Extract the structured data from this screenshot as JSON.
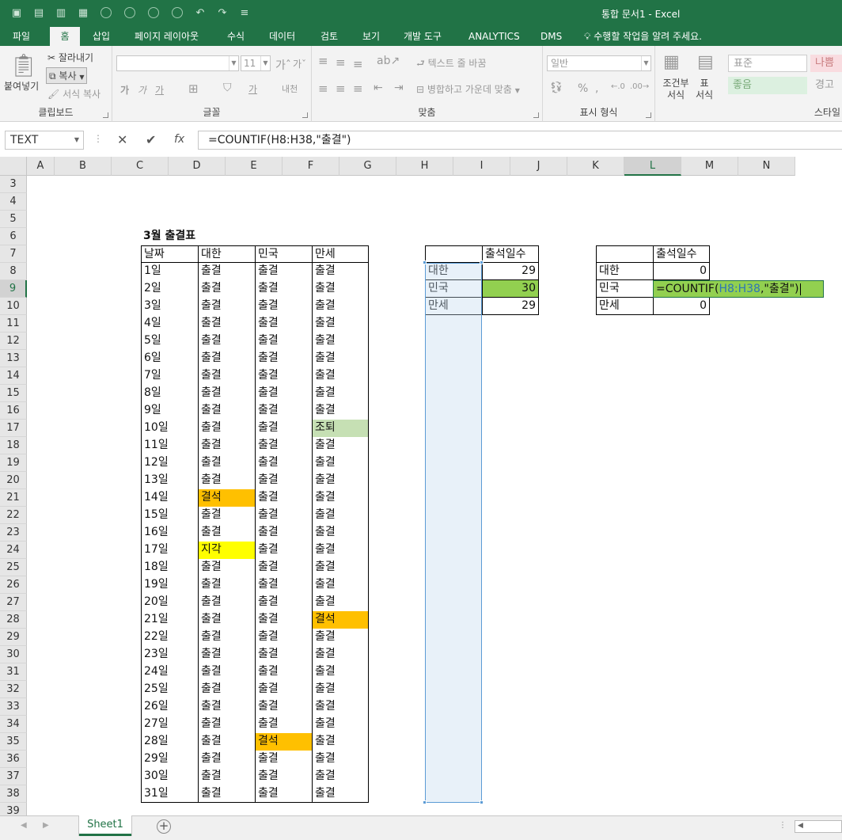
{
  "window": {
    "title": "통합 문서1 - Excel"
  },
  "tabs": [
    "파일",
    "홈",
    "삽입",
    "페이지 레이아웃",
    "수식",
    "데이터",
    "검토",
    "보기",
    "개발 도구",
    "ANALYTICS",
    "DMS"
  ],
  "tell_me": "수행할 작업을 알려 주세요.",
  "ribbon": {
    "clipboard": {
      "label": "클립보드",
      "paste": "붙여넣기",
      "cut": "잘라내기",
      "copy": "복사",
      "format_painter": "서식 복사"
    },
    "font": {
      "label": "글꼴",
      "size": "11"
    },
    "alignment": {
      "label": "맞춤",
      "wrap_text": "텍스트 줄 바꿈",
      "merge_center": "병합하고 가운데 맞춤"
    },
    "number": {
      "label": "표시 형식",
      "format": "일반"
    },
    "styles": {
      "label": "스타일",
      "conditional": "조건부 서식",
      "table": "표 서식",
      "normal": "표준",
      "bad": "나쁨",
      "good": "좋음",
      "warning": "경고"
    }
  },
  "formula_bar": {
    "name_box": "TEXT",
    "formula": "=COUNTIF(H8:H38,\"출결\")"
  },
  "columns": [
    "A",
    "B",
    "C",
    "D",
    "E",
    "F",
    "G",
    "H",
    "I",
    "J",
    "K",
    "L",
    "M",
    "N"
  ],
  "rows": [
    "3",
    "4",
    "5",
    "6",
    "7",
    "8",
    "9",
    "10",
    "11",
    "12",
    "13",
    "14",
    "15",
    "16",
    "17",
    "18",
    "19",
    "20",
    "21",
    "22",
    "23",
    "24",
    "25",
    "26",
    "27",
    "28",
    "29",
    "30",
    "31",
    "32",
    "33",
    "34",
    "35",
    "36",
    "37",
    "38",
    "39"
  ],
  "attendance": {
    "title": "3월 출결표",
    "headers": [
      "날짜",
      "대한",
      "민국",
      "만세"
    ],
    "rows": [
      [
        "1일",
        "출결",
        "출결",
        "출결"
      ],
      [
        "2일",
        "출결",
        "출결",
        "출결"
      ],
      [
        "3일",
        "출결",
        "출결",
        "출결"
      ],
      [
        "4일",
        "출결",
        "출결",
        "출결"
      ],
      [
        "5일",
        "출결",
        "출결",
        "출결"
      ],
      [
        "6일",
        "출결",
        "출결",
        "출결"
      ],
      [
        "7일",
        "출결",
        "출결",
        "출결"
      ],
      [
        "8일",
        "출결",
        "출결",
        "출결"
      ],
      [
        "9일",
        "출결",
        "출결",
        "출결"
      ],
      [
        "10일",
        "출결",
        "출결",
        "조퇴"
      ],
      [
        "11일",
        "출결",
        "출결",
        "출결"
      ],
      [
        "12일",
        "출결",
        "출결",
        "출결"
      ],
      [
        "13일",
        "출결",
        "출결",
        "출결"
      ],
      [
        "14일",
        "결석",
        "출결",
        "출결"
      ],
      [
        "15일",
        "출결",
        "출결",
        "출결"
      ],
      [
        "16일",
        "출결",
        "출결",
        "출결"
      ],
      [
        "17일",
        "지각",
        "출결",
        "출결"
      ],
      [
        "18일",
        "출결",
        "출결",
        "출결"
      ],
      [
        "19일",
        "출결",
        "출결",
        "출결"
      ],
      [
        "20일",
        "출결",
        "출결",
        "출결"
      ],
      [
        "21일",
        "출결",
        "출결",
        "결석"
      ],
      [
        "22일",
        "출결",
        "출결",
        "출결"
      ],
      [
        "23일",
        "출결",
        "출결",
        "출결"
      ],
      [
        "24일",
        "출결",
        "출결",
        "출결"
      ],
      [
        "25일",
        "출결",
        "출결",
        "출결"
      ],
      [
        "26일",
        "출결",
        "출결",
        "출결"
      ],
      [
        "27일",
        "출결",
        "출결",
        "출결"
      ],
      [
        "28일",
        "출결",
        "결석",
        "출결"
      ],
      [
        "29일",
        "출결",
        "출결",
        "출결"
      ],
      [
        "30일",
        "출결",
        "출결",
        "출결"
      ],
      [
        "31일",
        "출결",
        "출결",
        "출결"
      ]
    ]
  },
  "summary1": {
    "header": "출석일수",
    "rows": [
      [
        "대한",
        "29"
      ],
      [
        "민국",
        "30"
      ],
      [
        "만세",
        "29"
      ]
    ]
  },
  "summary2": {
    "header": "출석일수",
    "rows": [
      [
        "대한",
        "0"
      ],
      [
        "민국",
        ""
      ],
      [
        "만세",
        "0"
      ]
    ]
  },
  "edit_cell": {
    "prefix": "=COUNTIF(",
    "ref": "H8:H38",
    "suffix": ",\"출결\")"
  },
  "sheet_tab": "Sheet1",
  "colors": {
    "excel_green": "#217346",
    "absent": "#ffc000",
    "late": "#ffff00",
    "early_leave": "#c6e0b4",
    "highlight": "#92d050"
  }
}
